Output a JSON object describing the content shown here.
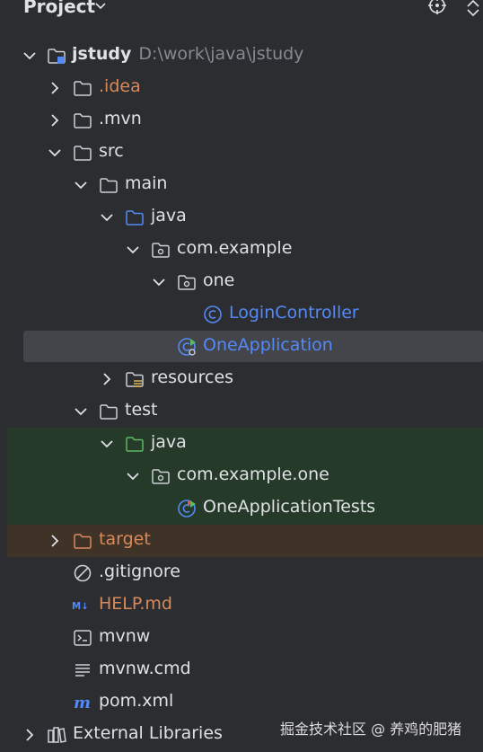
{
  "panel": {
    "title": "Project"
  },
  "tree": {
    "root": {
      "name": "jstudy",
      "path": "D:\\work\\java\\jstudy"
    },
    "idea": ".idea",
    "mvn": ".mvn",
    "src": "src",
    "main": "main",
    "main_java": "java",
    "com_example": "com.example",
    "one": "one",
    "login_controller": "LoginController",
    "one_application": "OneApplication",
    "resources": "resources",
    "test": "test",
    "test_java": "java",
    "com_example_one": "com.example.one",
    "one_application_tests": "OneApplicationTests",
    "target": "target",
    "gitignore": ".gitignore",
    "help_md": "HELP.md",
    "mvnw": "mvnw",
    "mvnw_cmd": "mvnw.cmd",
    "pom": "pom.xml",
    "external_libraries": "External Libraries"
  },
  "watermark": "掘金技术社区 @ 养鸡的肥猪",
  "colors": {
    "background": "#2b2d30",
    "text": "#dfe1e5",
    "blue": "#548af7",
    "orange": "#d98a5a",
    "selection": "#43454a",
    "test_highlight": "#263a2a",
    "excluded_highlight": "#3f3328"
  }
}
